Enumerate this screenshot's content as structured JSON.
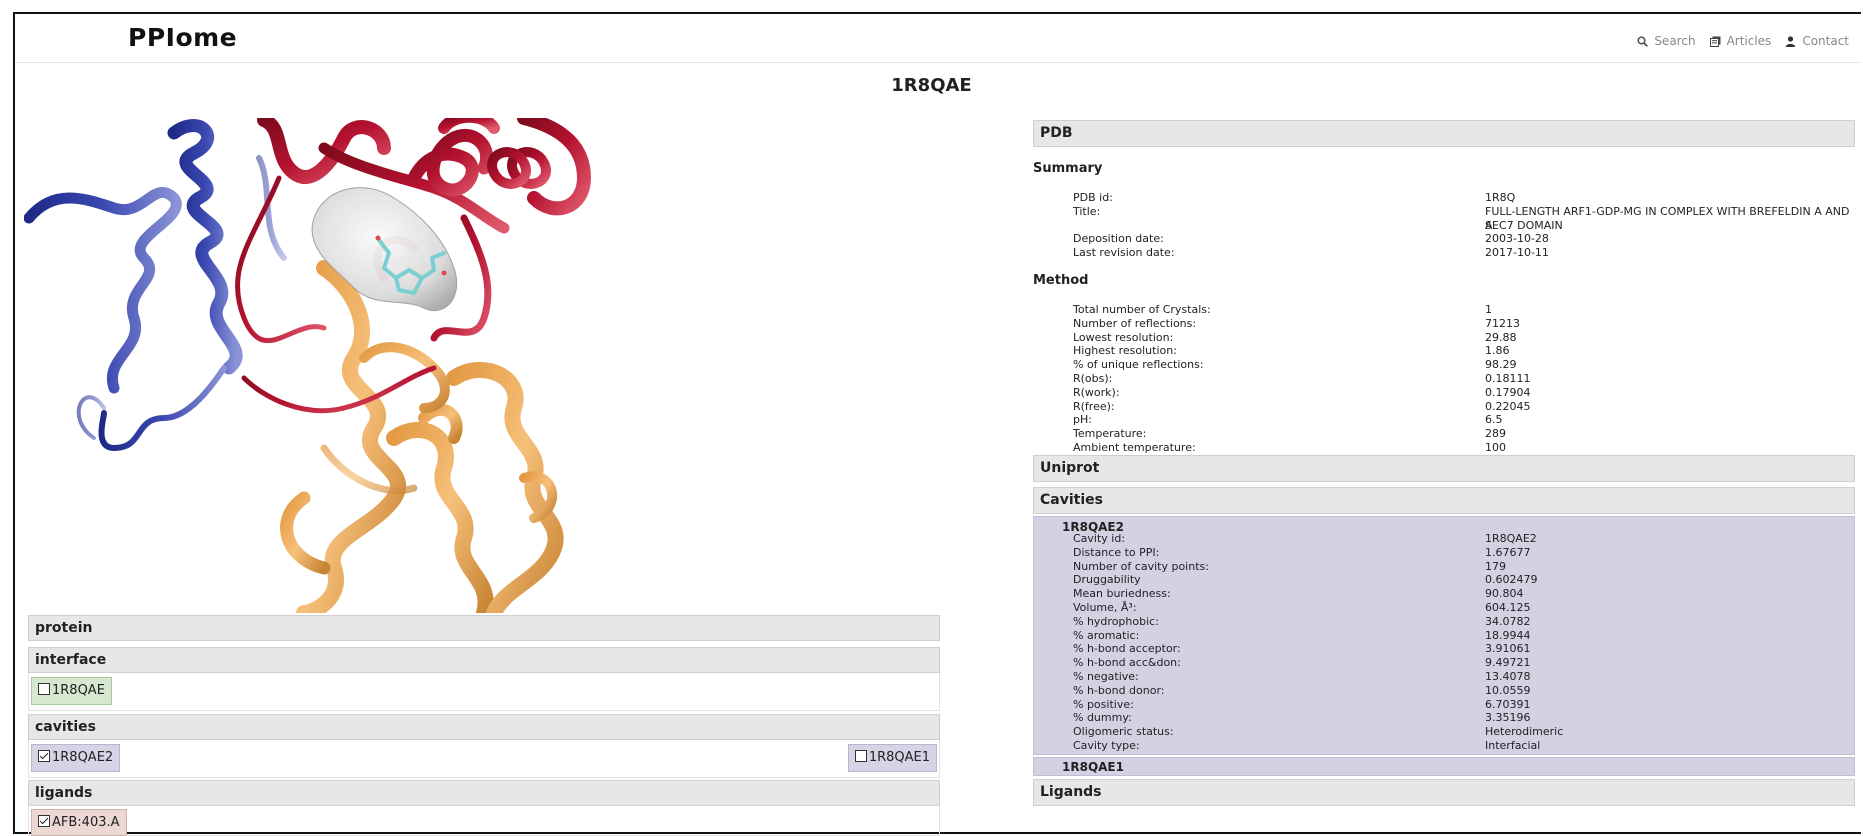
{
  "nav": {
    "brand": "PPIome",
    "links": [
      {
        "icon": "search-icon",
        "label": "Search"
      },
      {
        "icon": "articles-icon",
        "label": "Articles"
      },
      {
        "icon": "user-icon",
        "label": "Contact"
      }
    ]
  },
  "page_title": "1R8QAE",
  "left_panels": {
    "protein": {
      "title": "protein"
    },
    "interface": {
      "title": "interface",
      "items": [
        {
          "label": "1R8QAE",
          "checked": false
        }
      ]
    },
    "cavities": {
      "title": "cavities",
      "items": [
        {
          "label": "1R8QAE2",
          "checked": true
        },
        {
          "label": "1R8QAE1",
          "checked": false
        }
      ]
    },
    "ligands": {
      "title": "ligands",
      "items": [
        {
          "label": "AFB:403.A",
          "checked": true
        }
      ]
    }
  },
  "pdb": {
    "title": "PDB",
    "summary": {
      "title": "Summary",
      "rows": [
        {
          "k": "PDB id:",
          "v": "1R8Q"
        },
        {
          "k": "Title:",
          "v": "FULL-LENGTH ARF1-GDP-MG IN COMPLEX WITH BREFELDIN A AND A"
        },
        {
          "k": "",
          "v": "SEC7 DOMAIN"
        },
        {
          "k": "Deposition date:",
          "v": "2003-10-28"
        },
        {
          "k": "Last revision date:",
          "v": "2017-10-11"
        }
      ]
    },
    "method": {
      "title": "Method",
      "rows": [
        {
          "k": "Total number of Crystals:",
          "v": "1"
        },
        {
          "k": "Number of reflections:",
          "v": "71213"
        },
        {
          "k": "Lowest resolution:",
          "v": "29.88"
        },
        {
          "k": "Highest resolution:",
          "v": "1.86"
        },
        {
          "k": "% of unique reflections:",
          "v": "98.29"
        },
        {
          "k": "R(obs):",
          "v": "0.18111"
        },
        {
          "k": "R(work):",
          "v": "0.17904"
        },
        {
          "k": "R(free):",
          "v": "0.22045"
        },
        {
          "k": "pH:",
          "v": "6.5"
        },
        {
          "k": "Temperature:",
          "v": "289"
        },
        {
          "k": "Ambient temperature:",
          "v": "100"
        }
      ]
    }
  },
  "uniprot": {
    "title": "Uniprot"
  },
  "cavities": {
    "title": "Cavities",
    "items": [
      {
        "name": "1R8QAE2",
        "rows": [
          {
            "k": "Cavity id:",
            "v": "1R8QAE2"
          },
          {
            "k": "Distance to PPI:",
            "v": "1.67677"
          },
          {
            "k": "Number of cavity points:",
            "v": "179"
          },
          {
            "k": "Druggability",
            "v": "0.602479"
          },
          {
            "k": "Mean buriedness:",
            "v": "90.804"
          },
          {
            "k": "Volume, Å³:",
            "v": "604.125"
          },
          {
            "k": "% hydrophobic:",
            "v": "34.0782"
          },
          {
            "k": "% aromatic:",
            "v": "18.9944"
          },
          {
            "k": "% h-bond acceptor:",
            "v": "3.91061"
          },
          {
            "k": "% h-bond acc&don:",
            "v": "9.49721"
          },
          {
            "k": "% negative:",
            "v": "13.4078"
          },
          {
            "k": "% h-bond donor:",
            "v": "10.0559"
          },
          {
            "k": "% positive:",
            "v": "6.70391"
          },
          {
            "k": "% dummy:",
            "v": "3.35196"
          },
          {
            "k": "Oligomeric status:",
            "v": "Heterodimeric"
          },
          {
            "k": "Cavity type:",
            "v": "Interfacial"
          }
        ]
      },
      {
        "name": "1R8QAE1",
        "rows": []
      }
    ]
  },
  "ligands": {
    "title": "Ligands"
  },
  "colors": {
    "chain_blue": "#2e3a9a",
    "chain_red": "#a8102a",
    "chain_orange": "#f2b468",
    "cavity_surface": "#d9d9d9",
    "ligand": "#7ccfd0"
  }
}
